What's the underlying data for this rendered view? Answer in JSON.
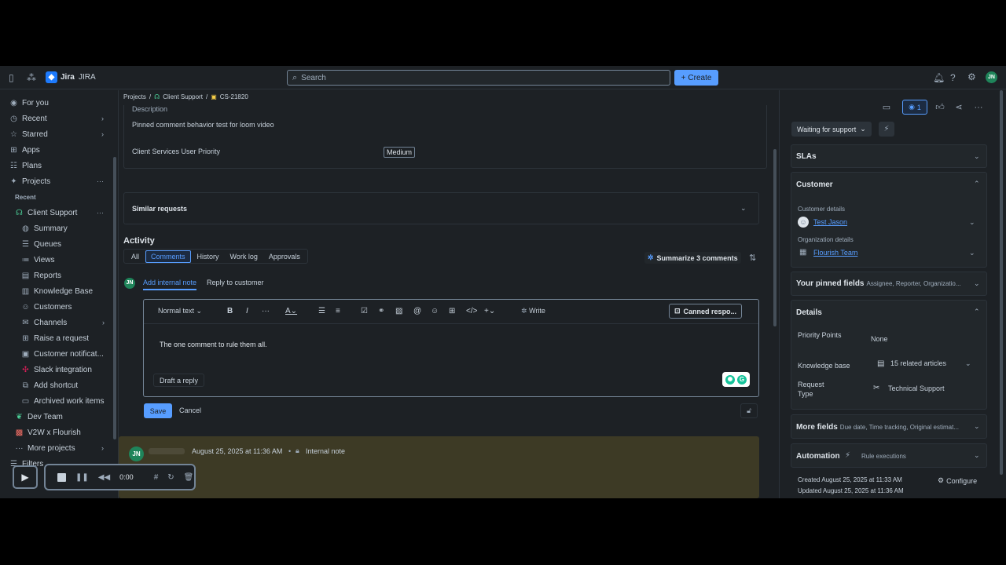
{
  "topbar": {
    "brand": "Jira",
    "site": "JIRA",
    "search_placeholder": "Search",
    "create_label": "Create",
    "user_initials": "JN"
  },
  "sidebar": {
    "items": [
      {
        "label": "For you",
        "icon": "user-circle-icon"
      },
      {
        "label": "Recent",
        "icon": "clock-icon"
      },
      {
        "label": "Starred",
        "icon": "star-icon"
      },
      {
        "label": "Apps",
        "icon": "apps-icon"
      },
      {
        "label": "Plans",
        "icon": "plans-icon"
      },
      {
        "label": "Projects",
        "icon": "projects-icon"
      }
    ],
    "recent_label": "Recent",
    "project": "Client Support",
    "sub_items": [
      "Summary",
      "Queues",
      "Views",
      "Reports",
      "Knowledge Base",
      "Customers",
      "Channels",
      "Raise a request",
      "Customer notificat...",
      "Slack integration",
      "Add shortcut",
      "Archived work items"
    ],
    "other_projects": [
      "Dev Team",
      "V2W x Flourish"
    ],
    "more_projects": "More projects",
    "filters": "Filters"
  },
  "breadcrumb": [
    "Projects",
    "Client Support",
    "CS-21820"
  ],
  "description": {
    "heading": "Description",
    "text": "Pinned comment behavior test for loom video",
    "priority_label": "Client Services User Priority",
    "priority_value": "Medium"
  },
  "similar": {
    "title": "Similar requests"
  },
  "activity": {
    "title": "Activity",
    "tabs": [
      "All",
      "Comments",
      "History",
      "Work log",
      "Approvals"
    ],
    "summarize": "Summarize 3 comments",
    "note_tabs": [
      "Add internal note",
      "Reply to customer"
    ],
    "user_initials": "JN"
  },
  "editor": {
    "text_style": "Normal text",
    "write": "Write",
    "canned": "Canned respo...",
    "body": "The one comment to rule them all.",
    "draft": "Draft a reply",
    "save": "Save",
    "cancel": "Cancel"
  },
  "comment": {
    "user_initials": "JN",
    "timestamp": "August 25, 2025 at 11:36 AM",
    "tag": "Internal note"
  },
  "right_panel": {
    "watch_count": "1",
    "status": "Waiting for support",
    "slas": "SLAs",
    "customer_title": "Customer",
    "customer_details_label": "Customer details",
    "customer_name": "Test Jason",
    "org_details_label": "Organization details",
    "org_name": "Flourish Team",
    "pinned_title": "Your pinned fields",
    "pinned_sub": "Assignee, Reporter, Organizatio...",
    "details_title": "Details",
    "priority_points_label": "Priority Points",
    "priority_points_value": "None",
    "kb_label": "Knowledge base",
    "kb_value": "15 related articles",
    "request_type_label": "Request Type",
    "request_type_value": "Technical Support",
    "more_fields_title": "More fields",
    "more_fields_sub": "Due date, Time tracking, Original estimat...",
    "automation_title": "Automation",
    "automation_sub": "Rule executions",
    "created": "Created August 25, 2025 at 11:33 AM",
    "updated": "Updated August 25, 2025 at 11:36 AM",
    "configure": "Configure"
  },
  "recorder": {
    "time": "0:00"
  },
  "colors": {
    "accent": "#579dff",
    "bg": "#1d2125",
    "comment_bg": "#3d3a25",
    "avatar": "#1f845a"
  }
}
